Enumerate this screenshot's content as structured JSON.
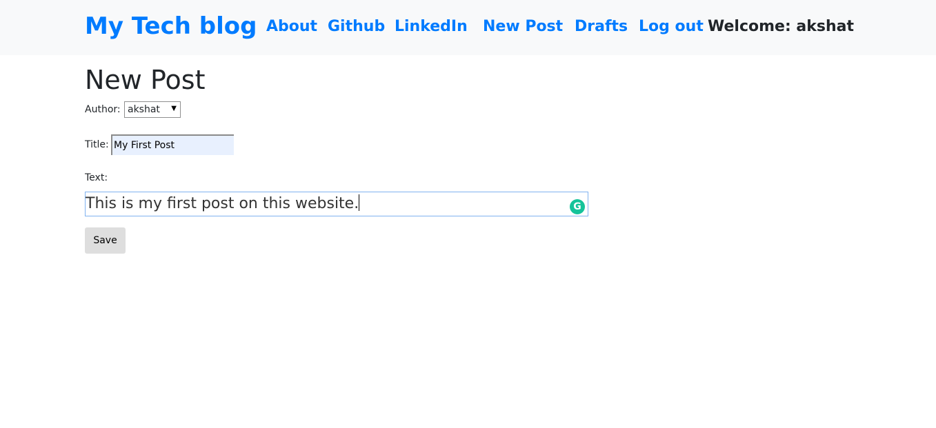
{
  "navbar": {
    "brand": "My Tech blog",
    "links": [
      "About",
      "Github",
      "LinkedIn",
      "New Post",
      "Drafts",
      "Log out"
    ],
    "welcome": "Welcome: akshat"
  },
  "page": {
    "title": "New Post"
  },
  "form": {
    "author_label": "Author:",
    "author_value": "akshat",
    "title_label": "Title:",
    "title_value": "My First Post",
    "text_label": "Text:",
    "text_value": "This is my first post on this website.",
    "grammarly_glyph": "G",
    "save_label": "Save"
  },
  "icons": {
    "grammarly": "grammarly-icon",
    "select_caret": "chevron-down-icon"
  },
  "colors": {
    "link": "#007bff",
    "navbar_bg": "#f8f9fa",
    "autofill_bg": "#e8f0fe",
    "grammarly": "#15c39a"
  }
}
